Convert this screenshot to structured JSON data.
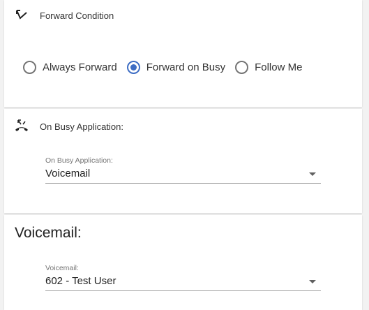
{
  "forward_condition": {
    "title": "Forward Condition",
    "icon": "call-forward-icon",
    "options": [
      {
        "label": "Always Forward",
        "checked": false
      },
      {
        "label": "Forward on Busy",
        "checked": true
      },
      {
        "label": "Follow Me",
        "checked": false
      }
    ]
  },
  "on_busy": {
    "title": "On Busy Application:",
    "icon": "call-busy-icon",
    "field_label": "On Busy Application:",
    "field_value": "Voicemail"
  },
  "voicemail": {
    "title": "Voicemail:",
    "field_label": "Voicemail:",
    "field_value": "602 - Test User"
  },
  "colors": {
    "accent": "#3f6ec4"
  }
}
